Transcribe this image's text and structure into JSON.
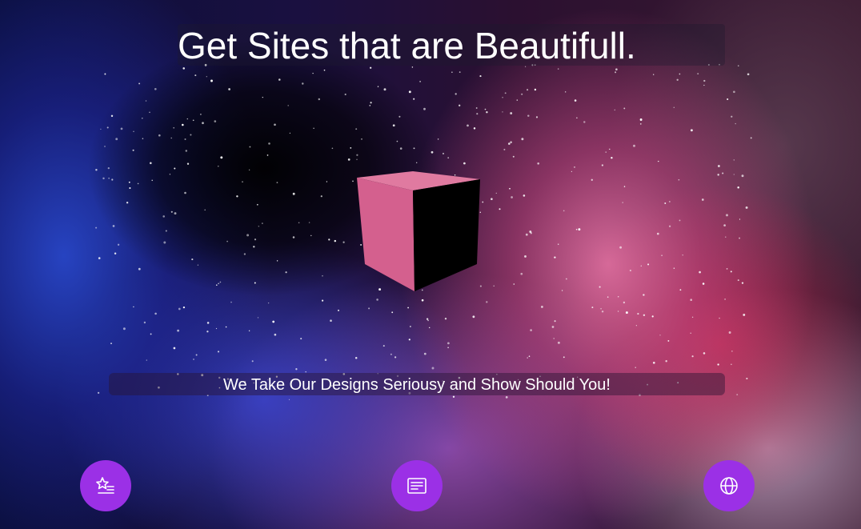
{
  "hero": {
    "title": "Get Sites that are Beautifull.",
    "subtitle": "We Take Our Designs Seriousy and Show Should You!"
  },
  "cube": {
    "front_color": "#d4608e",
    "side_color": "#000000",
    "top_color": "#e07aa0"
  },
  "features": [
    {
      "icon": "star-list-icon",
      "label": ""
    },
    {
      "icon": "document-text-icon",
      "label": ""
    },
    {
      "icon": "globe-icon",
      "label": ""
    }
  ],
  "colors": {
    "feature_circle": "#9b30e6",
    "text": "#ffffff"
  }
}
